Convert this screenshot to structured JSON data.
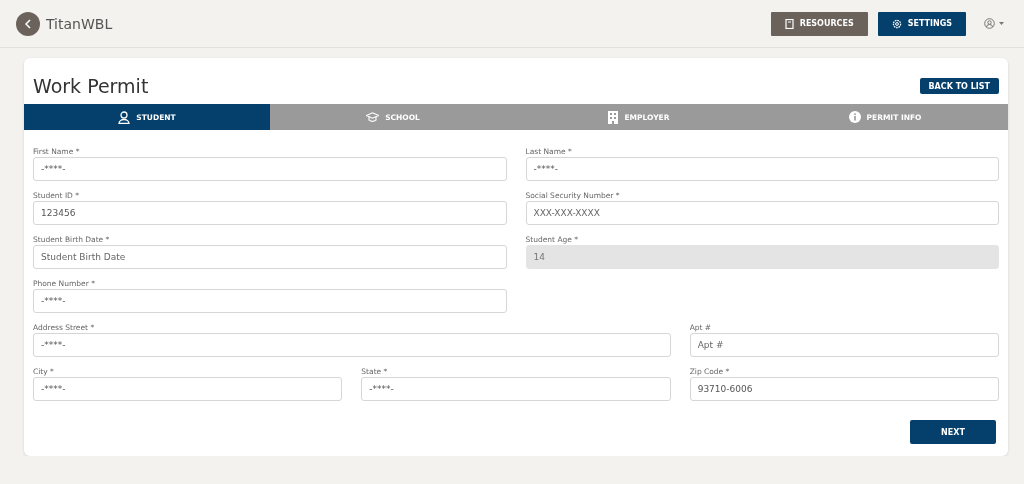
{
  "header": {
    "app_name": "TitanWBL",
    "buttons": [
      {
        "label": "RESOURCES",
        "kind": "resources"
      },
      {
        "label": "SETTINGS",
        "kind": "settings"
      }
    ]
  },
  "page": {
    "title": "Work Permit",
    "back_button": "BACK TO LIST"
  },
  "tabs": [
    {
      "label": "STUDENT",
      "kind": "student",
      "selected": true
    },
    {
      "label": "SCHOOL",
      "kind": "school",
      "selected": false
    },
    {
      "label": "EMPLOYER",
      "kind": "employer",
      "selected": false
    },
    {
      "label": "PERMIT INFO",
      "kind": "permit",
      "selected": false
    }
  ],
  "fields": [
    {
      "label": "First Name *",
      "value": "-****-",
      "disabled": false
    },
    {
      "label": "Last Name *",
      "value": "-****-",
      "disabled": false
    },
    {
      "label": "Student ID *",
      "value": "123456",
      "disabled": false
    },
    {
      "label": "Social Security Number *",
      "placeholder": "XXX-XXX-XXXX",
      "disabled": false
    },
    {
      "label": "Student Birth Date *",
      "placeholder": "Student Birth Date",
      "disabled": false
    },
    {
      "label": "Student Age *",
      "value": "14",
      "disabled": true
    },
    {
      "label": "Phone Number *",
      "value": "-****-",
      "disabled": false
    }
  ],
  "address_fields": [
    {
      "label": "Address Street *",
      "value": "-****-"
    },
    {
      "label": "Apt #",
      "placeholder": "Apt #"
    },
    {
      "label": "City *",
      "value": "-****-"
    },
    {
      "label": "State *",
      "value": "-****-"
    },
    {
      "label": "Zip Code *",
      "value": "93710-6006"
    }
  ],
  "next_button": "NEXT"
}
